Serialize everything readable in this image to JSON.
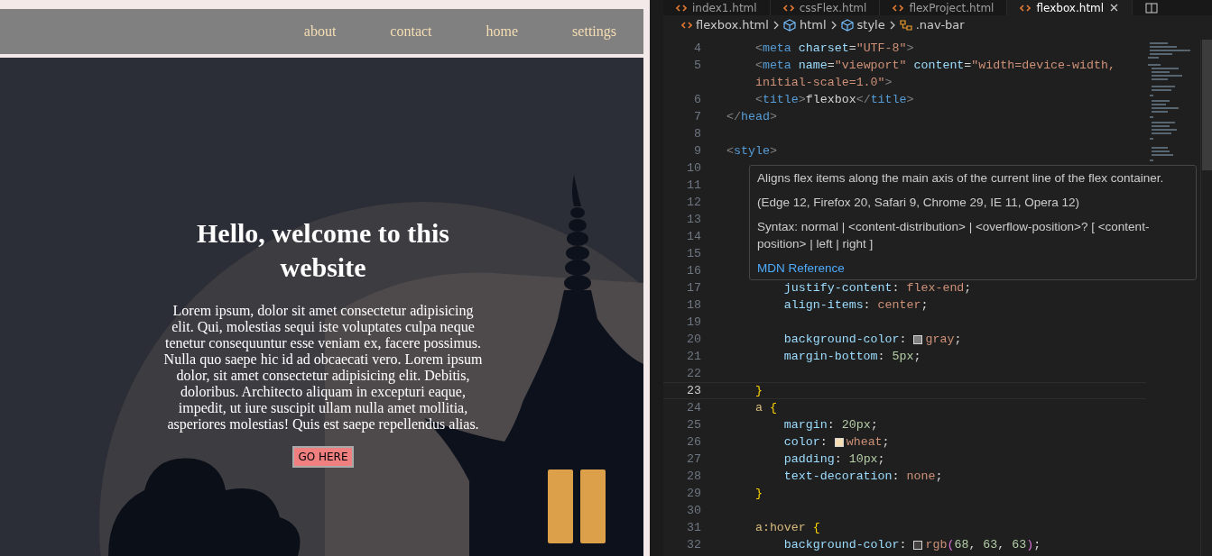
{
  "preview": {
    "nav_links": [
      {
        "label": "about"
      },
      {
        "label": "contact"
      },
      {
        "label": "home"
      },
      {
        "label": "settings"
      }
    ],
    "heading": "Hello, welcome to this website",
    "paragraph": "Lorem ipsum, dolor sit amet consectetur adipisicing elit. Qui, molestias sequi iste voluptates culpa neque tenetur consequuntur esse veniam ex, facere possimus. Nulla quo saepe hic id ad obcaecati vero. Lorem ipsum dolor, sit amet consectetur adipisicing elit. Debitis, doloribus. Architecto aliquam in excepturi eaque, impedit, ut iure suscipit ullam nulla amet mollitia, asperiores molestias! Quis est saepe repellendus alias.",
    "button": "GO HERE"
  },
  "editor": {
    "tabs": [
      {
        "label": "index1.html",
        "selected": false
      },
      {
        "label": "cssFlex.html",
        "selected": false
      },
      {
        "label": "flexProject.html",
        "selected": false
      },
      {
        "label": "flexbox.html",
        "selected": true
      }
    ],
    "breadcrumb": [
      {
        "label": "flexbox.html",
        "kind": "file"
      },
      {
        "label": "html",
        "kind": "element"
      },
      {
        "label": "style",
        "kind": "element"
      },
      {
        "label": ".nav-bar",
        "kind": "selector"
      }
    ],
    "code_lines": [
      {
        "number": "4",
        "current": false,
        "segments": [
          {
            "text": "    <",
            "kind": "punct"
          },
          {
            "text": "meta",
            "kind": "tag"
          },
          {
            "text": " charset",
            "kind": "attr"
          },
          {
            "text": "=",
            "kind": "text"
          },
          {
            "text": "\"UTF-8\"",
            "kind": "string"
          },
          {
            "text": ">",
            "kind": "punct"
          }
        ]
      },
      {
        "number": "5",
        "current": false,
        "segments": [
          {
            "text": "    <",
            "kind": "punct"
          },
          {
            "text": "meta",
            "kind": "tag"
          },
          {
            "text": " name",
            "kind": "attr"
          },
          {
            "text": "=",
            "kind": "text"
          },
          {
            "text": "\"viewport\"",
            "kind": "string"
          },
          {
            "text": " content",
            "kind": "attr"
          },
          {
            "text": "=",
            "kind": "text"
          },
          {
            "text": "\"width=device-width,",
            "kind": "string"
          }
        ]
      },
      {
        "current": false,
        "segments": [
          {
            "text": "    initial-scale=1.0\"",
            "kind": "string"
          },
          {
            "text": ">",
            "kind": "punct"
          }
        ]
      },
      {
        "number": "6",
        "current": false,
        "segments": [
          {
            "text": "    <",
            "kind": "punct"
          },
          {
            "text": "title",
            "kind": "tag"
          },
          {
            "text": ">",
            "kind": "punct"
          },
          {
            "text": "flexbox",
            "kind": "text"
          },
          {
            "text": "</",
            "kind": "punct"
          },
          {
            "text": "title",
            "kind": "tag"
          },
          {
            "text": ">",
            "kind": "punct"
          }
        ]
      },
      {
        "number": "7",
        "current": false,
        "segments": [
          {
            "text": "</",
            "kind": "punct"
          },
          {
            "text": "head",
            "kind": "tag"
          },
          {
            "text": ">",
            "kind": "punct"
          }
        ]
      },
      {
        "number": "8",
        "current": false
      },
      {
        "number": "9",
        "current": false,
        "segments": [
          {
            "text": "<",
            "kind": "punct"
          },
          {
            "text": "style",
            "kind": "tag"
          },
          {
            "text": ">",
            "kind": "punct"
          }
        ]
      },
      {
        "number": "10",
        "current": false
      },
      {
        "number": "11",
        "current": false
      },
      {
        "number": "12",
        "current": false
      },
      {
        "number": "13",
        "current": false
      },
      {
        "number": "14",
        "current": false
      },
      {
        "number": "15",
        "current": false
      },
      {
        "number": "16",
        "current": false
      },
      {
        "number": "17",
        "current": false,
        "segments": [
          {
            "text": "        justify-content",
            "kind": "prop"
          },
          {
            "text": ": ",
            "kind": "text"
          },
          {
            "text": "flex-end",
            "kind": "value"
          },
          {
            "text": ";",
            "kind": "text"
          }
        ]
      },
      {
        "number": "18",
        "current": false,
        "segments": [
          {
            "text": "        align-items",
            "kind": "prop"
          },
          {
            "text": ": ",
            "kind": "text"
          },
          {
            "text": "center",
            "kind": "value"
          },
          {
            "text": ";",
            "kind": "text"
          }
        ]
      },
      {
        "number": "19",
        "current": false
      },
      {
        "number": "20",
        "current": false,
        "segments": [
          {
            "text": "        background-color",
            "kind": "prop"
          },
          {
            "text": ": ",
            "kind": "text"
          },
          {
            "text": "gray",
            "kind": "value",
            "color": "#808080"
          },
          {
            "text": ";",
            "kind": "text"
          }
        ]
      },
      {
        "number": "21",
        "current": false,
        "segments": [
          {
            "text": "        margin-bottom",
            "kind": "prop"
          },
          {
            "text": ": ",
            "kind": "text"
          },
          {
            "text": "5",
            "kind": "number"
          },
          {
            "text": "px",
            "kind": "number"
          },
          {
            "text": ";",
            "kind": "text"
          }
        ]
      },
      {
        "number": "22",
        "current": false
      },
      {
        "number": "23",
        "current": true,
        "segments": [
          {
            "text": "    }",
            "kind": "brace"
          }
        ]
      },
      {
        "number": "24",
        "current": false,
        "segments": [
          {
            "text": "    a",
            "kind": "selector"
          },
          {
            "text": " {",
            "kind": "brace"
          }
        ]
      },
      {
        "number": "25",
        "current": false,
        "segments": [
          {
            "text": "        margin",
            "kind": "prop"
          },
          {
            "text": ": ",
            "kind": "text"
          },
          {
            "text": "20",
            "kind": "number"
          },
          {
            "text": "px",
            "kind": "number"
          },
          {
            "text": ";",
            "kind": "text"
          }
        ]
      },
      {
        "number": "26",
        "current": false,
        "segments": [
          {
            "text": "        color",
            "kind": "prop"
          },
          {
            "text": ": ",
            "kind": "text"
          },
          {
            "text": "wheat",
            "kind": "value",
            "color": "#f5deb3"
          },
          {
            "text": ";",
            "kind": "text"
          }
        ]
      },
      {
        "number": "27",
        "current": false,
        "segments": [
          {
            "text": "        padding",
            "kind": "prop"
          },
          {
            "text": ": ",
            "kind": "text"
          },
          {
            "text": "10",
            "kind": "number"
          },
          {
            "text": "px",
            "kind": "number"
          },
          {
            "text": ";",
            "kind": "text"
          }
        ]
      },
      {
        "number": "28",
        "current": false,
        "segments": [
          {
            "text": "        text-decoration",
            "kind": "prop"
          },
          {
            "text": ": ",
            "kind": "text"
          },
          {
            "text": "none",
            "kind": "value"
          },
          {
            "text": ";",
            "kind": "text"
          }
        ]
      },
      {
        "number": "29",
        "current": false,
        "segments": [
          {
            "text": "    }",
            "kind": "brace"
          }
        ]
      },
      {
        "number": "30",
        "current": false
      },
      {
        "number": "31",
        "current": false,
        "segments": [
          {
            "text": "    a:hover",
            "kind": "selector"
          },
          {
            "text": " {",
            "kind": "brace"
          }
        ]
      },
      {
        "number": "32",
        "current": false,
        "segments": [
          {
            "text": "        background-color",
            "kind": "prop"
          },
          {
            "text": ": ",
            "kind": "text"
          },
          {
            "text": "rgb",
            "kind": "value",
            "color": "#443f3f"
          },
          {
            "text": "(",
            "kind": "paren"
          },
          {
            "text": "68",
            "kind": "number"
          },
          {
            "text": ", ",
            "kind": "text"
          },
          {
            "text": "63",
            "kind": "number"
          },
          {
            "text": ", ",
            "kind": "text"
          },
          {
            "text": "63",
            "kind": "number"
          },
          {
            "text": ")",
            "kind": "paren"
          },
          {
            "text": ";",
            "kind": "text"
          }
        ]
      }
    ],
    "tooltip": {
      "description": "Aligns flex items along the main axis of the current line of the flex container.",
      "compatibility": "(Edge 12, Firefox 20, Safari 9, Chrome 29, IE 11, Opera 12)",
      "syntax": "Syntax: normal | <content-distribution> | <overflow-position>? [ <content-position> | left | right ]",
      "link": "MDN Reference"
    }
  }
}
